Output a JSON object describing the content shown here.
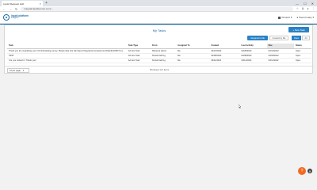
{
  "browser": {
    "tab_title": "Liquid Request Hub",
    "url": "integral.liquidsource.com/...",
    "new_tab": "+",
    "window_controls": [
      "—",
      "☐",
      "✕"
    ]
  },
  "header": {
    "logo_line1": "liquid platform",
    "logo_line2": "integral",
    "product": "Product",
    "user": "Paul Crosby"
  },
  "page": {
    "title": "My Tasks",
    "add_button": "+ New Task",
    "filters": {
      "assigned_to_me": "Assigned to Me",
      "created_by_me": "Created by Me",
      "open": "Open",
      "all": "All"
    }
  },
  "table": {
    "columns": [
      "Task",
      "Task Type",
      "From",
      "Assigned To",
      "Created",
      "Last Activity",
      "Due",
      "Status"
    ],
    "rows": [
      [
        "Thank you for completing your C3 Onboarding survey. Please take this link https://integral.forms.liquid.com/f/abcd12345/?x=a bb4xby...",
        "Ad Hoc Task",
        "Rebecca Harris",
        "Me",
        "02/10/2022",
        "02/28/2022",
        "02/10/2022",
        "Open"
      ],
      [
        "TEST",
        "Ad Hoc Task",
        "Kristal Fairring",
        "Me",
        "02/08/2022",
        "02/08/2022",
        "02/09/2022",
        "Open"
      ],
      [
        "Yes you rocked it ! Thank you!",
        "Ad Hoc Task",
        "Kristal Fairring",
        "Me",
        "03/11/2022",
        "03/11/2022",
        "03/11/2022",
        "Open"
      ]
    ]
  },
  "footer": {
    "per_page": "10 per page",
    "showing": "Showing 3 of 3 items"
  },
  "help_button": "?"
}
